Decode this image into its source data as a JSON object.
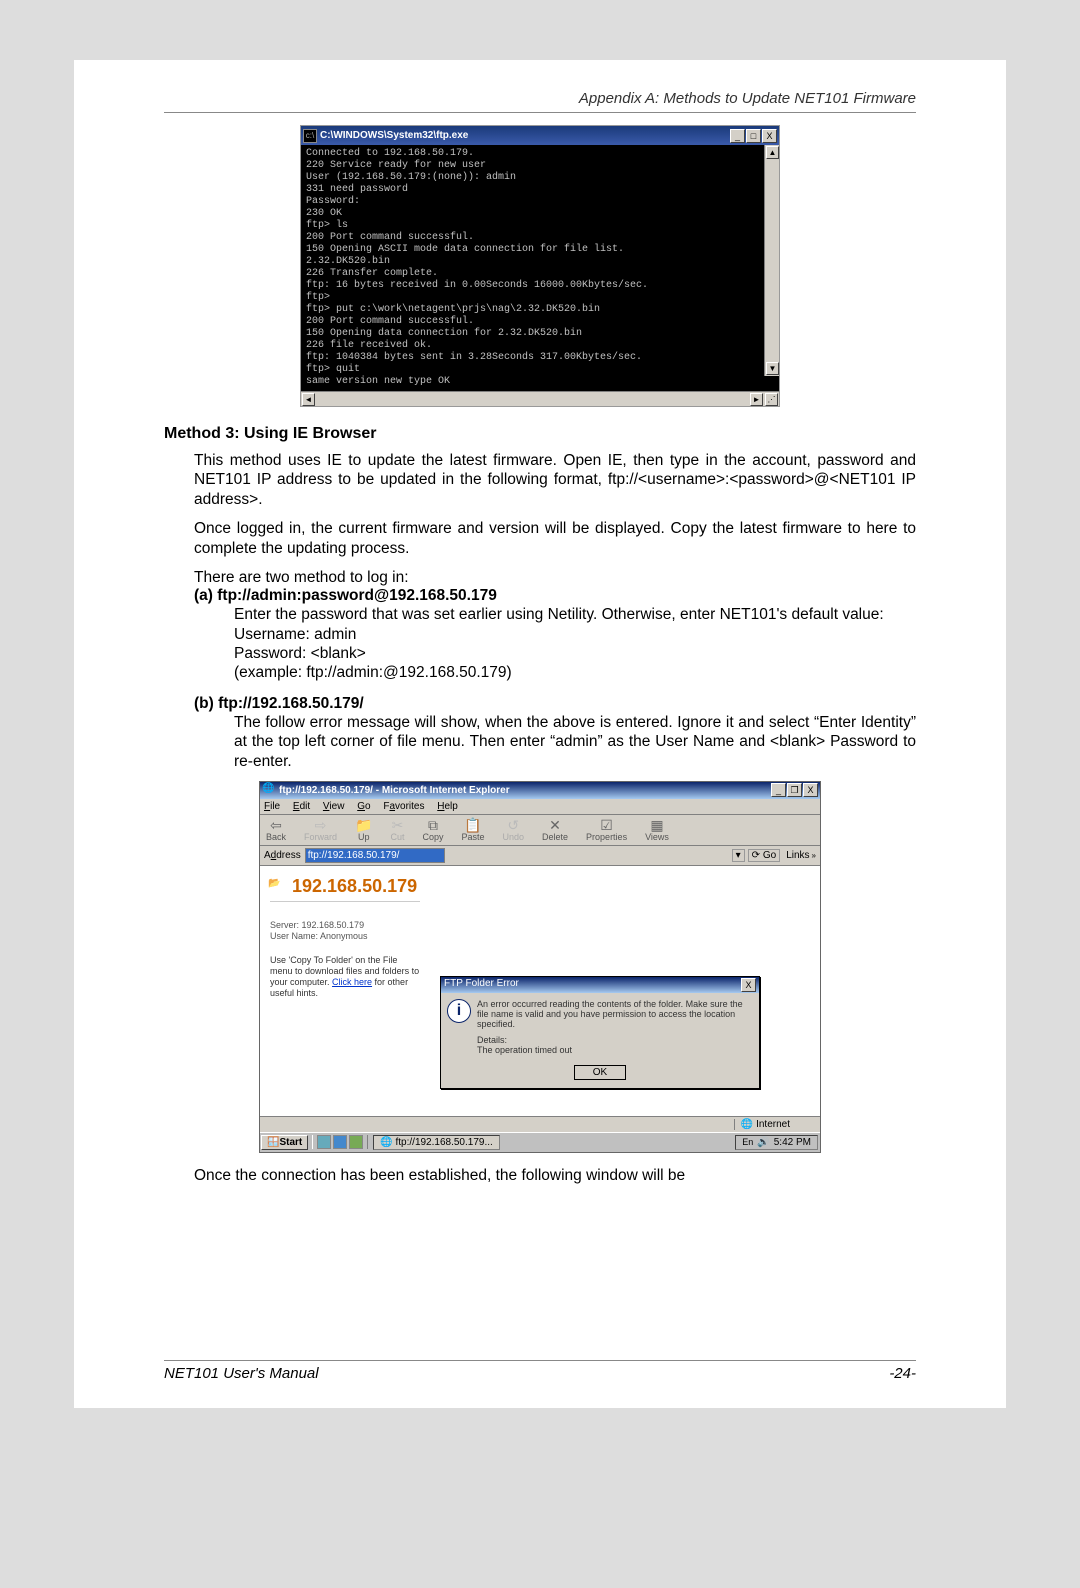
{
  "header": {
    "appendix": "Appendix A: Methods to Update NET101 Firmware"
  },
  "terminal": {
    "title": "C:\\WINDOWS\\System32\\ftp.exe",
    "icon_label": "cmd-icon",
    "lines": "Connected to 192.168.50.179.\n220 Service ready for new user\nUser (192.168.50.179:(none)): admin\n331 need password\nPassword:\n230 OK\nftp> ls\n200 Port command successful.\n150 Opening ASCII mode data connection for file list.\n2.32.DK520.bin\n226 Transfer complete.\nftp: 16 bytes received in 0.00Seconds 16000.00Kbytes/sec.\nftp>\nftp> put c:\\work\\netagent\\prjs\\nag\\2.32.DK520.bin\n200 Port command successful.\n150 Opening data connection for 2.32.DK520.bin\n226 file received ok.\nftp: 1040384 bytes sent in 3.28Seconds 317.00Kbytes/sec.\nftp> quit\nsame version new type OK"
  },
  "method3": {
    "heading": "Method 3: Using IE Browser",
    "p1": "This method uses IE to update the latest firmware. Open IE, then type in the account, password and NET101 IP address to be updated in the following format, ftp://<username>:<password>@<NET101 IP address>.",
    "p2": "Once logged in, the current firmware and version will be displayed. Copy the latest firmware to here to complete the updating process.",
    "p3": "There are two method to log in:",
    "a_title": "(a) ftp://admin:password@192.168.50.179",
    "a_l1": "Enter the password that was set earlier using Netility. Otherwise, enter NET101's default value:",
    "a_l2": "Username: admin",
    "a_l3": "Password: <blank>",
    "a_l4_a": "(example: ",
    "a_l4_b": "ftp://admin:@192.168.50.179",
    "a_l4_c": ")",
    "b_title": "(b) ftp://192.168.50.179/",
    "b_l1": "The follow error message will show, when the above is entered. Ignore it and select “Enter Identity” at the top left corner of file menu. Then enter “admin” as the User Name and <blank> Password to re-enter."
  },
  "ie": {
    "title": "ftp://192.168.50.179/ - Microsoft Internet Explorer",
    "menu": {
      "file": "File",
      "edit": "Edit",
      "view": "View",
      "go": "Go",
      "fav": "Favorites",
      "help": "Help"
    },
    "toolbar": {
      "back": "Back",
      "forward": "Forward",
      "up": "Up",
      "cut": "Cut",
      "copy": "Copy",
      "paste": "Paste",
      "undo": "Undo",
      "delete": "Delete",
      "props": "Properties",
      "views": "Views"
    },
    "addr_label": "Address",
    "addr_value": "ftp://192.168.50.179/",
    "go": "Go",
    "links": "Links",
    "page_title": "192.168.50.179",
    "server_line": "Server: 192.168.50.179",
    "user_line": "User Name: Anonymous",
    "hint_l1": "Use 'Copy To Folder' on the File menu to download files and folders to your computer. ",
    "hint_click": "Click here",
    "hint_l2": " for other useful hints.",
    "dialog": {
      "title": "FTP Folder Error",
      "msg": "An error occurred reading the contents of the folder.  Make sure the file name is valid and you have permission to access the location specified.",
      "details_lbl": "Details:",
      "details": "The operation timed out",
      "ok": "OK"
    },
    "status_zone": "Internet",
    "start": "Start",
    "task": "ftp://192.168.50.179...",
    "time": "5:42 PM"
  },
  "final": "Once the connection has been established, the following window will be",
  "footer": {
    "left": "NET101  User's  Manual",
    "right": "-24-"
  }
}
